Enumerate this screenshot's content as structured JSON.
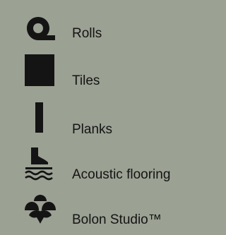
{
  "menu": {
    "items": [
      {
        "id": "rolls",
        "label": "Rolls",
        "icon": "roll-icon"
      },
      {
        "id": "tiles",
        "label": "Tiles",
        "icon": "tile-icon"
      },
      {
        "id": "planks",
        "label": "Planks",
        "icon": "plank-icon"
      },
      {
        "id": "acoustic",
        "label": "Acoustic flooring",
        "icon": "acoustic-flooring-icon"
      },
      {
        "id": "studio",
        "label": "Bolon Studio™",
        "icon": "bolon-studio-icon"
      }
    ]
  },
  "colors": {
    "background": "#9ba193",
    "foreground": "#141414"
  }
}
